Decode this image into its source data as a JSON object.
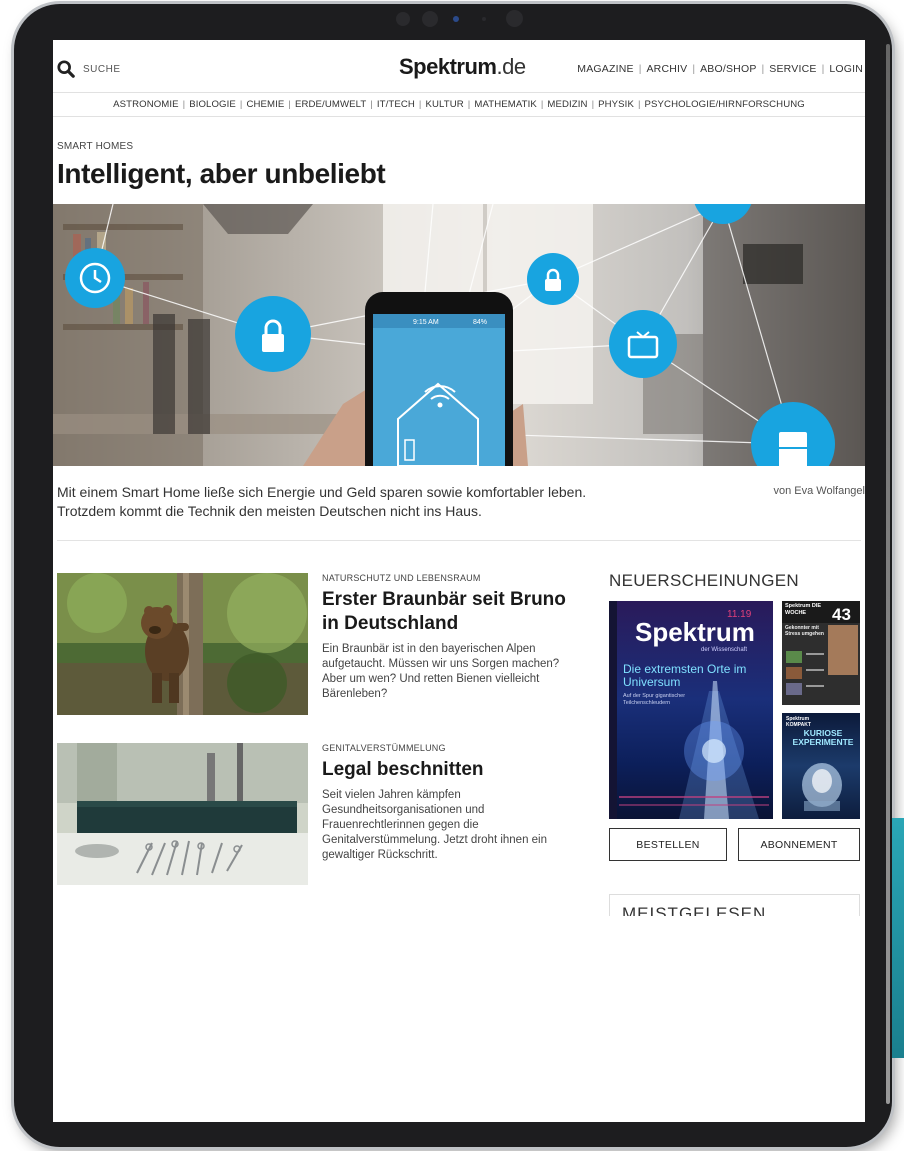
{
  "header": {
    "search_label": "SUCHE",
    "logo_main": "Spektrum",
    "logo_tld": ".de",
    "top_links": [
      "MAGAZINE",
      "ARCHIV",
      "ABO/SHOP",
      "SERVICE",
      "LOGIN"
    ]
  },
  "categories": [
    "ASTRONOMIE",
    "BIOLOGIE",
    "CHEMIE",
    "ERDE/UMWELT",
    "IT/TECH",
    "KULTUR",
    "MATHEMATIK",
    "MEDIZIN",
    "PHYSIK",
    "PSYCHOLOGIE/HIRNFORSCHUNG"
  ],
  "lead_article": {
    "kicker": "SMART HOMES",
    "title": "Intelligent, aber unbeliebt",
    "lede": "Mit einem Smart Home ließe sich Energie und Geld sparen sowie komfortabler leben. Trotzdem kommt die Technik den meisten Deutschen nicht ins Haus.",
    "byline": "von Eva Wolfangel",
    "phone_time": "9:15 AM",
    "phone_battery": "84%"
  },
  "teasers": [
    {
      "kicker": "NATURSCHUTZ UND LEBENSRAUM",
      "title": "Erster Braunbär seit Bruno in Deutschland",
      "text": "Ein Braunbär ist in den bayerischen Alpen aufgetaucht. Müssen wir uns Sorgen machen? Aber um wen? Und retten Bienen vielleicht Bärenleben?"
    },
    {
      "kicker": "GENITALVERSTÜMMELUNG",
      "title": "Legal beschnitten",
      "text": "Seit vielen Jahren kämpfen Gesundheitsorganisationen und Frauenrechtlerinnen gegen die Genitalverstümmelung. Jetzt droht ihnen ein gewaltiger Rückschritt."
    }
  ],
  "sidebar": {
    "title": "NEUERSCHEINUNGEN",
    "cover_main": {
      "issue": "11.19",
      "brand": "Spektrum",
      "subbrand": "der Wissenschaft",
      "headline": "Die extremsten Orte im Universum",
      "sub": "Auf der Spur gigantischer Teilchenschleudern"
    },
    "cover_week": {
      "brand": "Spektrum DIE WOCHE",
      "number": "43",
      "headline": "Gekonnter mit Stress umgehen"
    },
    "cover_kompakt": {
      "brand": "Spektrum KOMPAKT",
      "headline": "KURIOSE EXPERIMENTE"
    },
    "order_button": "BESTELLEN",
    "subscribe_button": "ABONNEMENT",
    "most_read": "MEISTGELESEN"
  }
}
